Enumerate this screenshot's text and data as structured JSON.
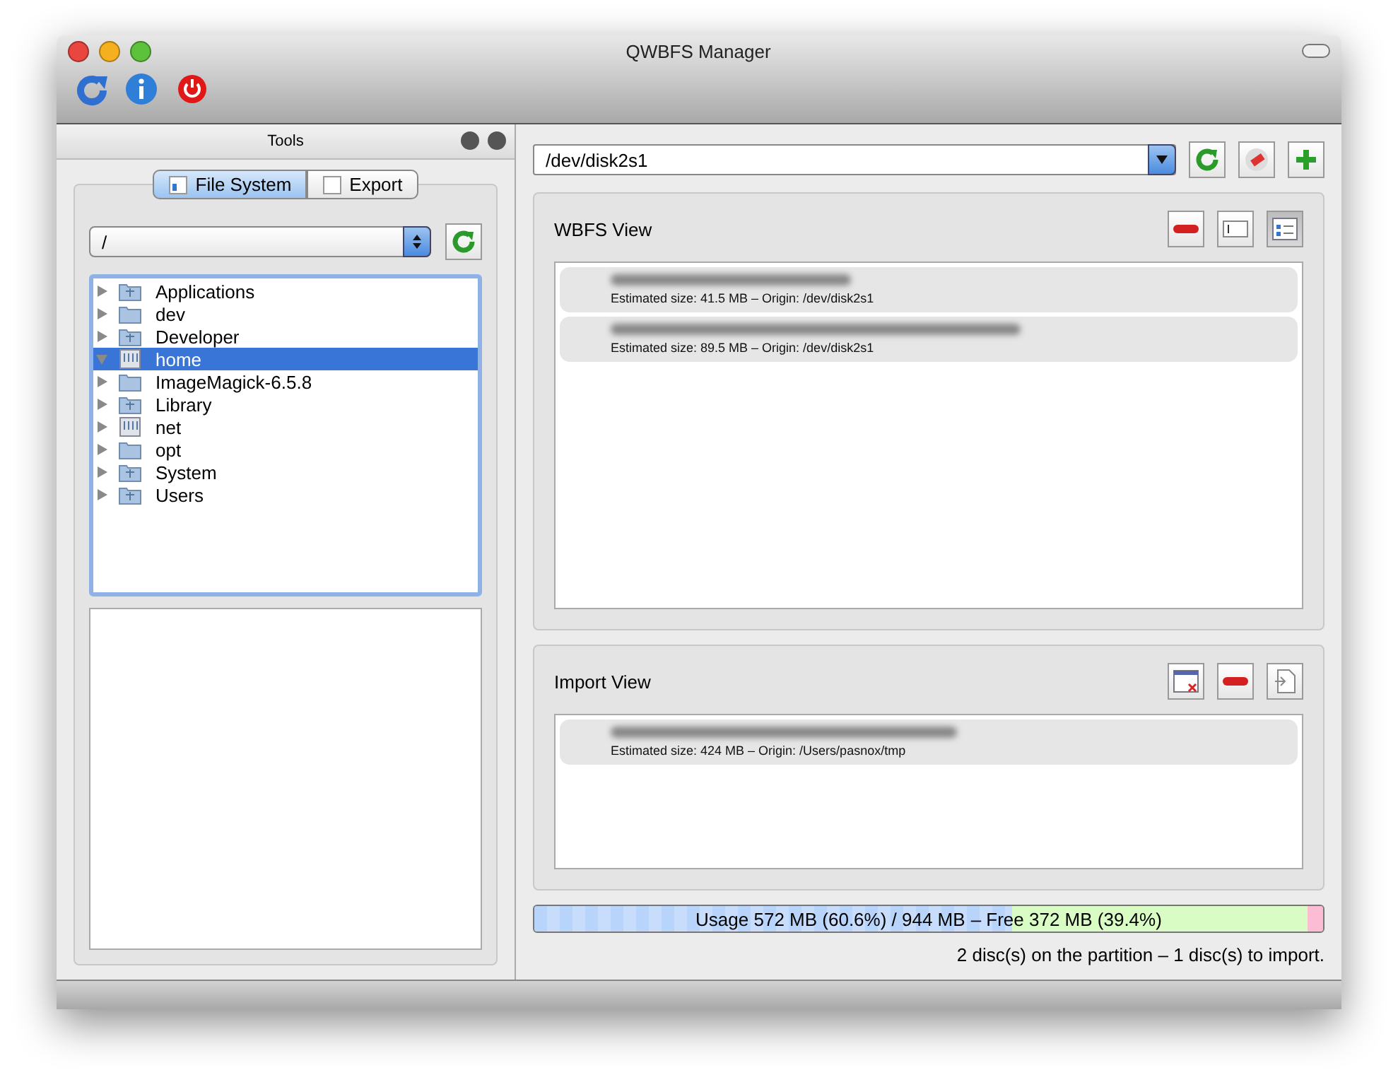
{
  "window": {
    "title": "QWBFS Manager"
  },
  "toolbar": [
    {
      "kind": "reload"
    },
    {
      "kind": "info"
    },
    {
      "kind": "quit"
    }
  ],
  "tools_dock": {
    "title": "Tools",
    "tabs": [
      {
        "label": "File System",
        "kind": "filesystem",
        "selected": true
      },
      {
        "label": "Export",
        "kind": "export",
        "selected": false
      }
    ],
    "path": "/",
    "tree": [
      {
        "name": "Applications",
        "kind": "apps",
        "expanded": false,
        "selected": false
      },
      {
        "name": "dev",
        "kind": "folder",
        "expanded": false,
        "selected": false
      },
      {
        "name": "Developer",
        "kind": "dev",
        "expanded": false,
        "selected": false
      },
      {
        "name": "home",
        "kind": "drive",
        "expanded": true,
        "selected": true
      },
      {
        "name": "ImageMagick-6.5.8",
        "kind": "folder",
        "expanded": false,
        "selected": false
      },
      {
        "name": "Library",
        "kind": "library",
        "expanded": false,
        "selected": false
      },
      {
        "name": "net",
        "kind": "drive",
        "expanded": false,
        "selected": false
      },
      {
        "name": "opt",
        "kind": "folder",
        "expanded": false,
        "selected": false
      },
      {
        "name": "System",
        "kind": "system",
        "expanded": false,
        "selected": false
      },
      {
        "name": "Users",
        "kind": "users",
        "expanded": false,
        "selected": false
      }
    ]
  },
  "partition": "/dev/disk2s1",
  "partition_tools": [
    {
      "kind": "reload"
    },
    {
      "kind": "erase"
    },
    {
      "kind": "add"
    }
  ],
  "wbfs_view": {
    "title": "WBFS View",
    "tools": [
      {
        "kind": "remove",
        "pressed": false
      },
      {
        "kind": "rename",
        "pressed": false
      },
      {
        "kind": "details",
        "pressed": true
      }
    ],
    "discs": [
      {
        "info": "Estimated size: 41.5 MB – Origin: /dev/disk2s1"
      },
      {
        "info": "Estimated size: 89.5 MB – Origin: /dev/disk2s1"
      }
    ]
  },
  "import_view": {
    "title": "Import View",
    "tools": [
      {
        "kind": "clear",
        "pressed": false
      },
      {
        "kind": "remove",
        "pressed": false
      },
      {
        "kind": "import",
        "pressed": false
      }
    ],
    "discs": [
      {
        "info": "Estimated size: 424 MB – Origin: /Users/pasnox/tmp"
      }
    ]
  },
  "usage": {
    "level": 0.606,
    "used": "Usage 572 MB (60.6%) / 944 MB",
    "free": "– Free 372 MB (39.4%)"
  },
  "summary": "2 disc(s) on the partition – 1 disc(s) to import."
}
